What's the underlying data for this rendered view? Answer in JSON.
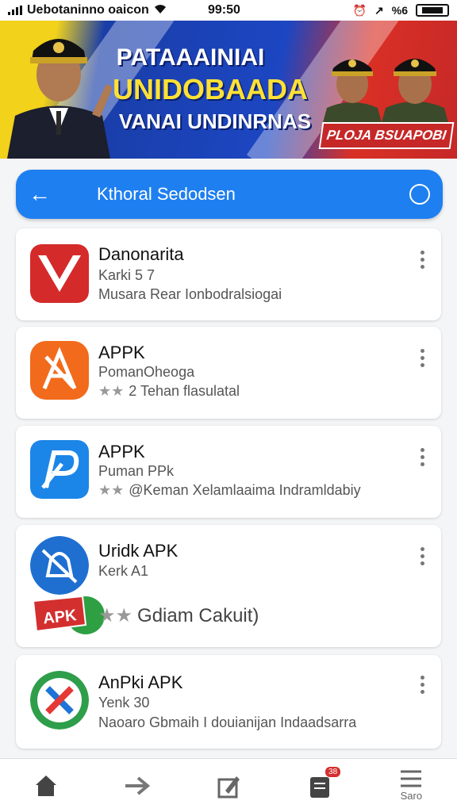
{
  "status_bar": {
    "carrier": "Uebotaninno oaicon",
    "time": "99:50",
    "battery": "%6"
  },
  "banner": {
    "line1": "PATAAAINIAI",
    "line2": "UNIDOBAADA",
    "line3": "VANAI UNDINRNAS",
    "tag": "PLOJA BSUAPOBI"
  },
  "search": {
    "query": "Kthoral Sedodsen"
  },
  "apps": [
    {
      "title": "Danonarita",
      "line1": "Karki 5 7",
      "line2": "Musara Rear Ionbodralsiogai",
      "stars": ""
    },
    {
      "title": "APPK",
      "line1": "PomanOheoga",
      "line2": "2 Tehan flasulatal",
      "stars": "★★"
    },
    {
      "title": "APPK",
      "line1": "Puman PPk",
      "line2": "@Keman Xelamlaaima Indramldabiy",
      "stars": "★★"
    },
    {
      "title": "Uridk APK",
      "line1": "Kerk A1",
      "line2": "Gdiam Cakuit)",
      "stars": "★★",
      "sticker": "APK"
    },
    {
      "title": "AnPki APK",
      "line1": "Yenk 30",
      "line2": "Naoaro Gbmaih I douianijan Indaadsarra",
      "stars": ""
    }
  ],
  "nav": {
    "badge": "38",
    "more_label": "Saro"
  }
}
